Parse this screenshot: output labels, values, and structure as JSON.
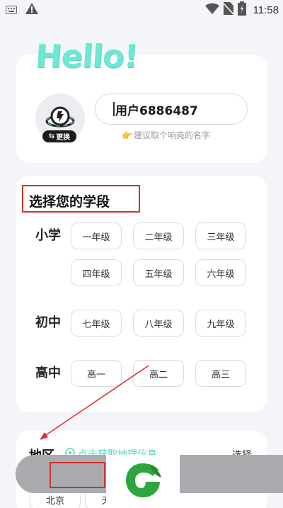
{
  "status_bar": {
    "time": "11:58"
  },
  "header": {
    "hello": "Hello!"
  },
  "profile": {
    "avatar_badge_label": "更换",
    "nickname_value": "用户6886487",
    "hint": "建议取个响亮的名字"
  },
  "grade_section": {
    "title": "选择您的学段",
    "rows": [
      {
        "label": "小学",
        "grades": [
          "一年级",
          "二年级",
          "三年级",
          "四年级",
          "五年级",
          "六年级"
        ]
      },
      {
        "label": "初中",
        "grades": [
          "七年级",
          "八年级",
          "九年级"
        ]
      },
      {
        "label": "高中",
        "grades": [
          "高一",
          "高二",
          "高三"
        ]
      }
    ]
  },
  "region_section": {
    "title": "地区",
    "tip": "点击获取地理信息",
    "choose_label": "选择",
    "chips": [
      "北京",
      "天"
    ]
  },
  "colors": {
    "accent": "#5ad2c0",
    "highlight_box": "#d32f2f",
    "hello": "#6fe7d5"
  }
}
